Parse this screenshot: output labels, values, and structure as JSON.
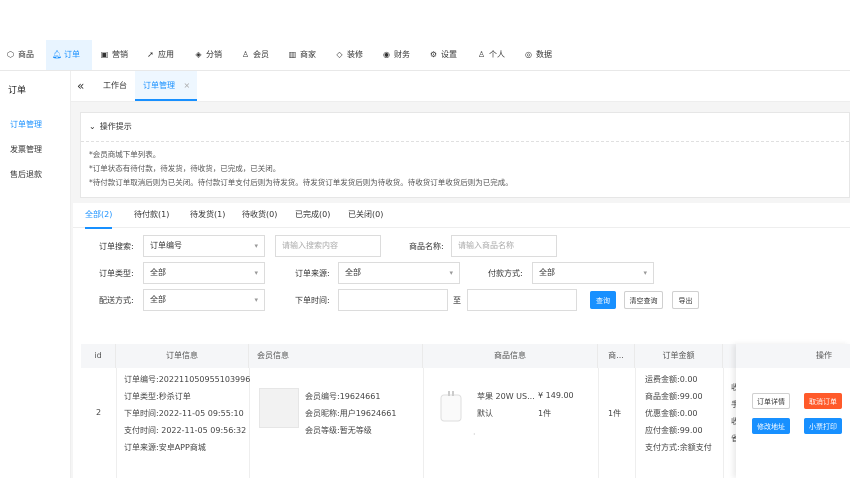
{
  "topnav": {
    "items": [
      {
        "label": "商品",
        "icon": "goods-icon"
      },
      {
        "label": "订单",
        "icon": "bell-icon"
      },
      {
        "label": "营销",
        "icon": "marketing-icon"
      },
      {
        "label": "应用",
        "icon": "send-icon"
      },
      {
        "label": "分销",
        "icon": "layers-icon"
      },
      {
        "label": "会员",
        "icon": "user-icon"
      },
      {
        "label": "商家",
        "icon": "shop-icon"
      },
      {
        "label": "装修",
        "icon": "tag-icon"
      },
      {
        "label": "财务",
        "icon": "finance-icon"
      },
      {
        "label": "设置",
        "icon": "gear-icon"
      },
      {
        "label": "个人",
        "icon": "person-icon"
      },
      {
        "label": "数据",
        "icon": "globe-icon"
      }
    ],
    "active_index": 1
  },
  "sidebar": {
    "title": "订单",
    "items": [
      {
        "label": "订单管理"
      },
      {
        "label": "发票管理"
      },
      {
        "label": "售后退款"
      }
    ]
  },
  "tabs": {
    "collapse_glyph": "«",
    "items": [
      {
        "label": "工作台"
      },
      {
        "label": "订单管理",
        "close": "×"
      }
    ]
  },
  "tips": {
    "title": "操作提示",
    "lines": [
      "*会员商城下单列表。",
      "*订单状态有待付款，待发货，待收货，已完成，已关闭。",
      "*待付款订单取消后则为已关闭。待付款订单支付后则为待发货。待发货订单发货后则为待收货。待收货订单收货后则为已完成。"
    ]
  },
  "status_tabs": [
    {
      "label": "全部(2)"
    },
    {
      "label": "待付款(1)"
    },
    {
      "label": "待发货(1)"
    },
    {
      "label": "待收货(0)"
    },
    {
      "label": "已完成(0)"
    },
    {
      "label": "已关闭(0)"
    }
  ],
  "filters": {
    "order_search_label": "订单搜索:",
    "order_search_type": "订单编号",
    "search_placeholder": "请输入搜索内容",
    "product_name_label": "商品名称:",
    "product_name_placeholder": "请输入商品名称",
    "order_type_label": "订单类型:",
    "order_type_value": "全部",
    "order_source_label": "订单来源:",
    "order_source_value": "全部",
    "pay_method_label": "付款方式:",
    "pay_method_value": "全部",
    "delivery_label": "配送方式:",
    "delivery_value": "全部",
    "order_time_label": "下单时间:",
    "date_sep": "至",
    "query_button": "查询",
    "clear_button": "清空查询",
    "export_button": "导出"
  },
  "table": {
    "headers": [
      "id",
      "订单信息",
      "会员信息",
      "商品信息",
      "商...",
      "订单金额",
      "操作"
    ],
    "row": {
      "id": "2",
      "order_no": "订单编号:202211050955103996",
      "order_type": "订单类型:秒杀订单",
      "order_time": "下单时间:2022-11-05 09:55:10",
      "pay_time": "支付时间: 2022-11-05 09:56:32",
      "source": "订单来源:安卓APP商城",
      "member_no": "会员编号:19624661",
      "member_nick": "会员昵称:用户19624661",
      "member_level": "会员等级:暂无等级",
      "product_name": "苹果 20W US...",
      "product_price": "¥ 149.00",
      "product_spec": "默认",
      "product_qty": "1件",
      "product_dot": "·",
      "count": "1件",
      "freight": "运费金额:0.00",
      "goods_amount": "商品金额:99.00",
      "discount": "优惠金额:0.00",
      "payable": "应付金额:99.00",
      "pay_way": "支付方式:余额支付",
      "truncated": [
        "收",
        "手",
        "收",
        "省"
      ],
      "btn_detail": "订单详情",
      "btn_cancel": "取消订单",
      "btn_modify_addr": "修改地址",
      "btn_print": "小票打印"
    }
  }
}
